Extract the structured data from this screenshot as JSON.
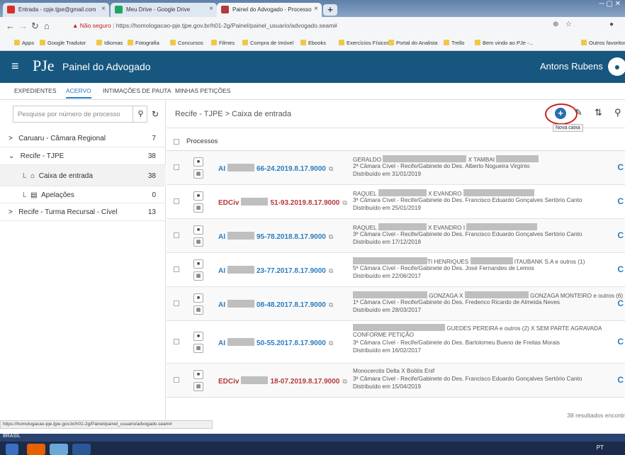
{
  "browser": {
    "tabs": [
      {
        "label": "Entrada - cpje.tjpe@gmail.com",
        "color": "#d93025"
      },
      {
        "label": "Meu Drive - Google Drive",
        "color": "#1fa463"
      },
      {
        "label": "Painel do Advogado - Processo",
        "color": "#b33a3a"
      }
    ],
    "insecure_label": "Não seguro",
    "url": "https://homologacao-pje.tjpe.gov.br/h01-2g/Painel/painel_usuario/advogado.seam#",
    "bookmarks": [
      "Apps",
      "Google Tradutor",
      "Idiomas",
      "Fotografia",
      "Concursos",
      "Filmes",
      "Compra de Imóvel",
      "Ebooks",
      "Exercícios Físicos",
      "Portal do Analista",
      "Trello",
      "Bem vindo ao PJe -..."
    ],
    "other_bookmarks": "Outros favoritos",
    "status_url": "https://homologacao-pje.tjpe.gov.br/h01-2g/Painel/painel_usuario/advogado.seam#"
  },
  "header": {
    "logo_text": "PJe",
    "title": "Painel do Advogado",
    "user": "Antons Rubens"
  },
  "nav_tabs": [
    "EXPEDIENTES",
    "ACERVO",
    "INTIMAÇÕES DE PAUTA",
    "MINHAS PETIÇÕES"
  ],
  "sidebar": {
    "search_placeholder": "Pesquise por número de processo",
    "items": [
      {
        "label": "Caruaru - Câmara Regional",
        "count": "7"
      },
      {
        "label": "Recife - TJPE",
        "count": "38"
      },
      {
        "label": "Caixa de entrada",
        "count": "38"
      },
      {
        "label": "Apelações",
        "count": "0"
      },
      {
        "label": "Recife - Turma Recursal - Cível",
        "count": "13"
      }
    ]
  },
  "content": {
    "breadcrumb": "Recife - TJPE > Caixa de entrada",
    "tooltip": "Nova caixa",
    "processos_label": "Processos",
    "rows": [
      {
        "cls": "AI",
        "num": "66-24.2019.8.17.9000",
        "parte1": "GERALDO",
        "parte2": "X TAMBAI",
        "camara": "2ª Câmara Cível - Recife/Gabinete do Des. Alberto Nogueira Virgínio",
        "dist": "Distribuído em 31/01/2019"
      },
      {
        "cls": "EDCiv",
        "num": "51-93.2019.8.17.9000",
        "parte1": "RAQUEL",
        "parte2": "X EVANDRO",
        "camara": "3ª Câmara Cível - Recife/Gabinete do Des. Francisco Eduardo Gonçalves Sertório Canto",
        "dist": "Distribuído em 25/01/2019"
      },
      {
        "cls": "AI",
        "num": "95-78.2018.8.17.9000",
        "parte1": "RAQUEL",
        "parte2": "X EVANDRO I",
        "camara": "3ª Câmara Cível - Recife/Gabinete do Des. Francisco Eduardo Gonçalves Sertório Canto",
        "dist": "Distribuído em 17/12/2018"
      },
      {
        "cls": "AI",
        "num": "23-77.2017.8.17.9000",
        "parte1": "TI HENRIQUES",
        "parte2": "ITAUBANK S.A e outros (1)",
        "camara": "5ª Câmara Cível - Recife/Gabinete do Des. José Fernandes de Lemos",
        "dist": "Distribuído em 22/06/2017"
      },
      {
        "cls": "AI",
        "num": "08-48.2017.8.17.9000",
        "parte1": "GONZAGA X",
        "parte2": "GONZAGA MONTEIRO e outros (6)",
        "camara": "1ª Câmara Cível - Recife/Gabinete do Des. Frederico Ricardo de Almeida Neves",
        "dist": "Distribuído em 28/03/2017"
      },
      {
        "cls": "AI",
        "num": "50-55.2017.8.17.9000",
        "parte1": "GUEDES PEREIRA e outros (2) X SEM PARTE AGRAVADA",
        "parte2": "CONFORME PETIÇÃO",
        "camara": "3ª Câmara Cível - Recife/Gabinete do Des. Bartolomeu Bueno de Freitas Morais",
        "dist": "Distribuído em 16/02/2017"
      },
      {
        "cls": "EDCiv",
        "num": "18-07.2019.8.17.9000",
        "parte1": "Monocerotis Delta X Boötis Enif",
        "parte2": "",
        "camara": "3ª Câmara Cível - Recife/Gabinete do Des. Francisco Eduardo Gonçalves Sertório Canto",
        "dist": "Distribuído em 15/04/2019"
      }
    ],
    "results": "38 resultados encontr"
  },
  "taskbar": {
    "locale": "BRASIL",
    "lang": "PT"
  }
}
